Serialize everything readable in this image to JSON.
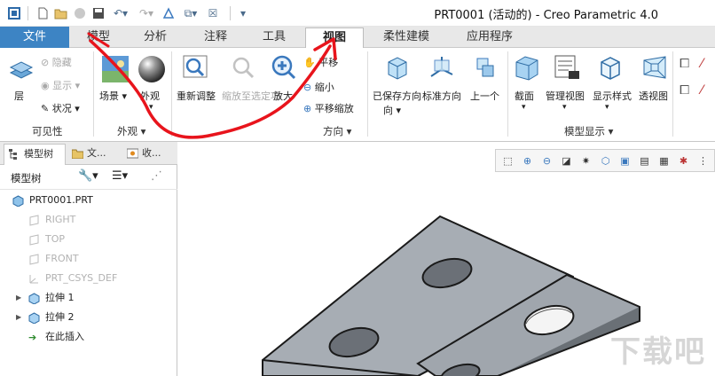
{
  "window": {
    "title": "PRT0001 (活动的) - Creo Parametric 4.0"
  },
  "quick_access": {
    "icons": [
      "app-icon",
      "new-icon",
      "open-icon",
      "regenerate-icon",
      "save-icon",
      "undo-icon",
      "redo-icon",
      "feature-icon",
      "window-icon",
      "close-window-icon",
      "customize-icon"
    ]
  },
  "tabs": [
    {
      "label": "文件"
    },
    {
      "label": "模型"
    },
    {
      "label": "分析"
    },
    {
      "label": "注释"
    },
    {
      "label": "工具"
    },
    {
      "label": "视图"
    },
    {
      "label": "柔性建模"
    },
    {
      "label": "应用程序"
    }
  ],
  "ribbon": {
    "visibility": {
      "group_label": "可见性",
      "layer": "层",
      "hide": "隐藏",
      "show": "显示",
      "status": "状况"
    },
    "appearance": {
      "group_label": "外观",
      "scene": "场景",
      "appearance": "外观"
    },
    "orientation": {
      "group_label": "方向",
      "refit": "重新调整",
      "zoom_to_selected": "缩放至选定项",
      "zoom_in": "放大",
      "pan": "平移",
      "zoom_out": "缩小",
      "pan_zoom": "平移缩放",
      "saved_orientations": "已保存方向",
      "standard_orientation": "标准方向",
      "previous": "上一个"
    },
    "model_display": {
      "group_label": "模型显示",
      "section": "截面",
      "manage_views": "管理视图",
      "display_style": "显示样式",
      "perspective_view": "透视图"
    }
  },
  "left_panel": {
    "tabs": [
      {
        "label": "模型树"
      },
      {
        "label": "文..."
      },
      {
        "label": "收..."
      }
    ],
    "toolbar_label": "模型树",
    "tree": [
      {
        "label": "PRT0001.PRT",
        "dim": false
      },
      {
        "label": "RIGHT",
        "dim": true
      },
      {
        "label": "TOP",
        "dim": true
      },
      {
        "label": "FRONT",
        "dim": true
      },
      {
        "label": "PRT_CSYS_DEF",
        "dim": true
      },
      {
        "label": "拉伸 1",
        "dim": false
      },
      {
        "label": "拉伸 2",
        "dim": false
      },
      {
        "label": "在此插入",
        "dim": false
      }
    ]
  },
  "viewport": {
    "watermark": "下载吧"
  },
  "colors": {
    "file_tab": "#3d84c4",
    "model_face": "#a7adb4",
    "annotation": "#e8141c"
  }
}
